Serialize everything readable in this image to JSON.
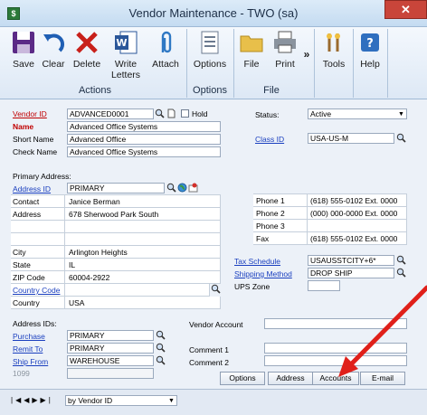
{
  "window": {
    "title": "Vendor Maintenance  -  TWO (sa)",
    "close": "✕"
  },
  "ribbon": {
    "actions": {
      "save": "Save",
      "clear": "Clear",
      "delete": "Delete",
      "write_letters": "Write Letters",
      "attach": "Attach",
      "group": "Actions"
    },
    "options": {
      "label": "Options",
      "group": "Options"
    },
    "file": {
      "file": "File",
      "print": "Print",
      "group": "File"
    },
    "tools": "Tools",
    "help": "Help",
    "more": "»"
  },
  "form": {
    "vendor_id": {
      "label": "Vendor ID",
      "value": "ADVANCED0001"
    },
    "hold": "Hold",
    "name": {
      "label": "Name",
      "value": "Advanced Office Systems"
    },
    "short_name": {
      "label": "Short Name",
      "value": "Advanced Office"
    },
    "check_name": {
      "label": "Check Name",
      "value": "Advanced Office Systems"
    },
    "status": {
      "label": "Status:",
      "value": "Active"
    },
    "class_id": {
      "label": "Class ID",
      "value": "USA-US-M"
    },
    "primary_address": "Primary Address:",
    "address_id": {
      "label": "Address ID",
      "value": "PRIMARY"
    },
    "contact": {
      "label": "Contact",
      "value": "Janice Berman"
    },
    "address": {
      "label": "Address",
      "value": "678 Sherwood Park South"
    },
    "city": {
      "label": "City",
      "value": "Arlington Heights"
    },
    "state": {
      "label": "State",
      "value": "IL"
    },
    "zip": {
      "label": "ZIP Code",
      "value": "60004-2922"
    },
    "country_code": {
      "label": "Country Code",
      "value": ""
    },
    "country": {
      "label": "Country",
      "value": "USA"
    },
    "phone1": {
      "label": "Phone 1",
      "value": "(618) 555-0102  Ext. 0000"
    },
    "phone2": {
      "label": "Phone 2",
      "value": "(000) 000-0000  Ext. 0000"
    },
    "phone3": {
      "label": "Phone 3",
      "value": ""
    },
    "fax": {
      "label": "Fax",
      "value": "(618) 555-0102  Ext. 0000"
    },
    "tax_schedule": {
      "label": "Tax Schedule",
      "value": "USAUSSTCITY+6*"
    },
    "shipping_method": {
      "label": "Shipping Method",
      "value": "DROP SHIP"
    },
    "ups_zone": {
      "label": "UPS Zone",
      "value": ""
    },
    "address_ids": "Address IDs:",
    "purchase": {
      "label": "Purchase",
      "value": "PRIMARY"
    },
    "remit_to": {
      "label": "Remit To",
      "value": "PRIMARY"
    },
    "ship_from": {
      "label": "Ship From",
      "value": "WAREHOUSE"
    },
    "form_1099": {
      "label": "1099",
      "value": ""
    },
    "vendor_account": {
      "label": "Vendor Account",
      "value": ""
    },
    "comment1": {
      "label": "Comment 1",
      "value": ""
    },
    "comment2": {
      "label": "Comment 2",
      "value": ""
    }
  },
  "buttons": {
    "options": "Options",
    "address": "Address",
    "accounts": "Accounts",
    "email": "E-mail"
  },
  "footer": {
    "sort": "by Vendor ID"
  },
  "colors": {
    "annotation_arrow": "#e0201a"
  }
}
